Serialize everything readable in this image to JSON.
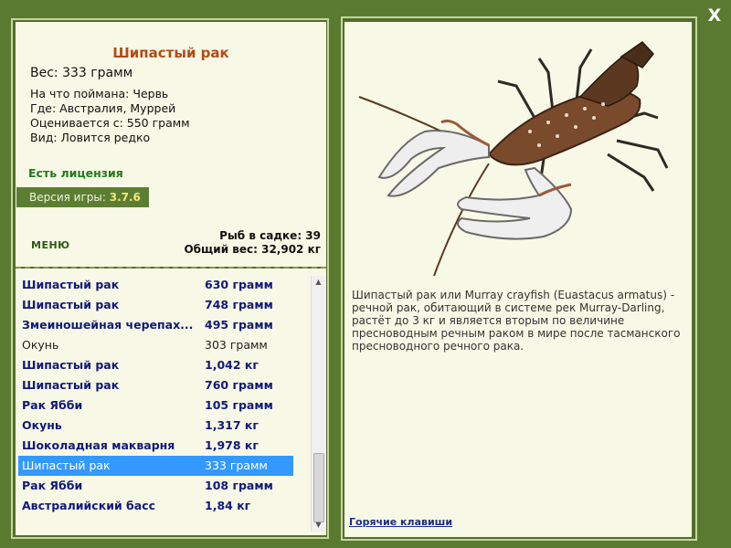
{
  "close_label": "X",
  "fish": {
    "title": "Шипастый рак",
    "weight": "Вес: 333 грамм",
    "bait": "На что поймана: Червь",
    "location": "Где: Австралия, Муррей",
    "value": "Оценивается с: 550 грамм",
    "rarity": "Вид: Ловится редко"
  },
  "license": "Есть лицензия",
  "version": {
    "label": "Версия игры:",
    "value": "3.7.6"
  },
  "menu_label": "МЕНЮ",
  "cage": {
    "count": "Рыб в садке: 39",
    "total": "Общий вес: 32,902 кг"
  },
  "catches": [
    {
      "name": "Шипастый рак",
      "weight": "630 грамм",
      "style": "bold"
    },
    {
      "name": "Шипастый рак",
      "weight": "748 грамм",
      "style": "bold"
    },
    {
      "name": "Змеиношейная черепах...",
      "weight": "495 грамм",
      "style": "bold"
    },
    {
      "name": "Окунь",
      "weight": "303 грамм",
      "style": "plain"
    },
    {
      "name": "Шипастый рак",
      "weight": "1,042 кг",
      "style": "bold"
    },
    {
      "name": "Шипастый рак",
      "weight": "760 грамм",
      "style": "bold"
    },
    {
      "name": "Рак Ябби",
      "weight": "105 грамм",
      "style": "bold"
    },
    {
      "name": "Окунь",
      "weight": "1,317 кг",
      "style": "bold"
    },
    {
      "name": "Шоколадная макварня",
      "weight": "1,978 кг",
      "style": "bold"
    },
    {
      "name": "Шипастый рак",
      "weight": "333 грамм",
      "style": "selected"
    },
    {
      "name": "Рак Ябби",
      "weight": "108 грамм",
      "style": "bold"
    },
    {
      "name": "Австралийский басс",
      "weight": "1,84 кг",
      "style": "bold"
    }
  ],
  "description": "Шипастый рак или Murray crayfish (Euastacus armatus) - речной рак, обитающий в системе рек Murray-Darling, растёт до 3 кг и является вторым по величине пресноводным речным раком в мире после тасманского пресноводного речного рака.",
  "hotkeys_label": "Горячие клавиши",
  "colors": {
    "background": "#5a7b2f",
    "panel": "#f8f8e6",
    "title": "#b34a14",
    "license": "#227a1c",
    "list_text": "#101a78",
    "selection": "#3399ff"
  },
  "icons": {
    "close": "close-icon",
    "scroll_up": "arrow-up-icon",
    "scroll_down": "arrow-down-icon"
  }
}
